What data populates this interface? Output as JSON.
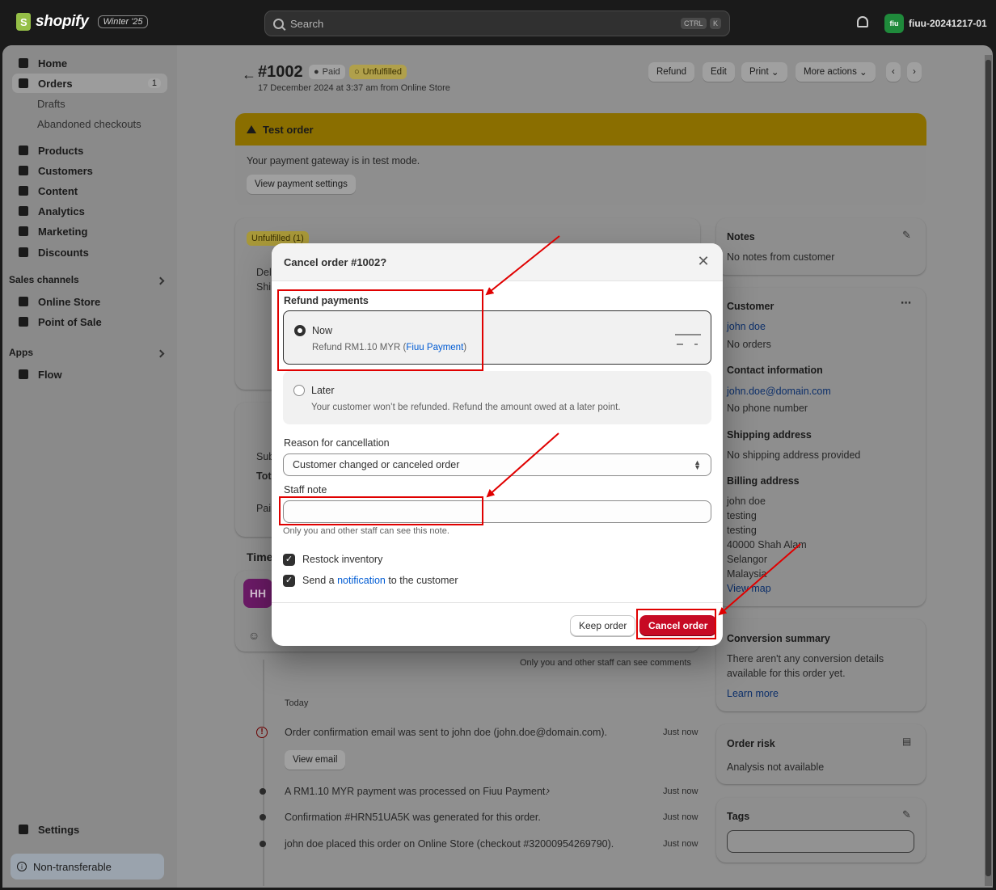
{
  "topbar": {
    "brand": "shopify",
    "edition": "Winter '25",
    "search_placeholder": "Search",
    "shortcut_ctrl": "CTRL",
    "shortcut_k": "K",
    "store_avatar": "fiu",
    "store_name": "fiuu-20241217-01"
  },
  "sidebar": {
    "items": [
      {
        "label": "Home",
        "icon": "home-icon"
      },
      {
        "label": "Orders",
        "icon": "inbox-icon",
        "count": "1"
      },
      {
        "label": "Drafts"
      },
      {
        "label": "Abandoned checkouts"
      },
      {
        "label": "Products",
        "icon": "tag-icon"
      },
      {
        "label": "Customers",
        "icon": "person-icon"
      },
      {
        "label": "Content",
        "icon": "image-icon"
      },
      {
        "label": "Analytics",
        "icon": "chart-icon"
      },
      {
        "label": "Marketing",
        "icon": "target-icon"
      },
      {
        "label": "Discounts",
        "icon": "discount-icon"
      }
    ],
    "sales_channels_label": "Sales channels",
    "channels": [
      "Online Store",
      "Point of Sale"
    ],
    "apps_label": "Apps",
    "apps": [
      "Flow"
    ],
    "settings_label": "Settings",
    "non_transferable": "Non-transferable"
  },
  "order": {
    "id": "#1002",
    "paid": "Paid",
    "unfulfilled": "Unfulfilled",
    "meta": "17 December 2024 at 3:37 am from Online Store",
    "actions": [
      "Refund",
      "Edit",
      "Print",
      "More actions"
    ]
  },
  "test_banner": {
    "title": "Test order",
    "text": "Your payment gateway is in test mode.",
    "button": "View payment settings"
  },
  "fulfillment": {
    "badge": "Unfulfilled (1)",
    "del": "Del",
    "ship": "Shi"
  },
  "payment_card": {
    "sub": "Sub",
    "tot": "Tot",
    "pai": "Pai"
  },
  "timeline": {
    "title": "Time",
    "avatar": "HH",
    "staff_comment_note": "Only you and other staff can see comments",
    "day": "Today",
    "events": [
      {
        "text": "Order confirmation email was sent to john doe (john.doe@domain.com).",
        "time": "Just now",
        "button": "View email"
      },
      {
        "text": "A RM1.10 MYR payment was processed on Fiuu Payment.",
        "time": "Just now"
      },
      {
        "text": "Confirmation #HRN51UA5K was generated for this order.",
        "time": "Just now"
      },
      {
        "text": "john doe placed this order on Online Store (checkout #32000954269790).",
        "time": "Just now"
      }
    ]
  },
  "right": {
    "notes_title": "Notes",
    "notes_text": "No notes from customer",
    "customer_title": "Customer",
    "customer_name": "john doe",
    "customer_orders": "No orders",
    "contact_title": "Contact information",
    "contact_email": "john.doe@domain.com",
    "contact_phone": "No phone number",
    "shipping_title": "Shipping address",
    "shipping_text": "No shipping address provided",
    "billing_title": "Billing address",
    "billing_lines": [
      "john doe",
      "testing",
      "testing",
      "40000 Shah Alam",
      "Selangor",
      "Malaysia"
    ],
    "view_map": "View map",
    "conversion_title": "Conversion summary",
    "conversion_text1": "There aren't any conversion details",
    "conversion_text2": "available for this order yet.",
    "learn_more": "Learn more",
    "risk_title": "Order risk",
    "risk_text": "Analysis not available",
    "tags_title": "Tags"
  },
  "modal": {
    "title": "Cancel order #1002?",
    "refund_label": "Refund payments",
    "now_title": "Now",
    "now_sub_prefix": "Refund RM1.10 MYR (",
    "now_sub_link": "Fiuu Payment",
    "now_sub_suffix": ")",
    "later_title": "Later",
    "later_sub": "Your customer won’t be refunded. Refund the amount owed at a later point.",
    "reason_label": "Reason for cancellation",
    "reason_value": "Customer changed or canceled order",
    "staff_note_label": "Staff note",
    "staff_note_value": "",
    "staff_note_help": "Only you and other staff can see this note.",
    "restock_label": "Restock inventory",
    "notify_prefix": "Send a ",
    "notify_link": "notification",
    "notify_suffix": " to the customer",
    "keep_button": "Keep order",
    "cancel_button": "Cancel order"
  },
  "colors": {
    "danger": "#c70a24",
    "annotation": "#e00000",
    "link": "#005bd3"
  }
}
